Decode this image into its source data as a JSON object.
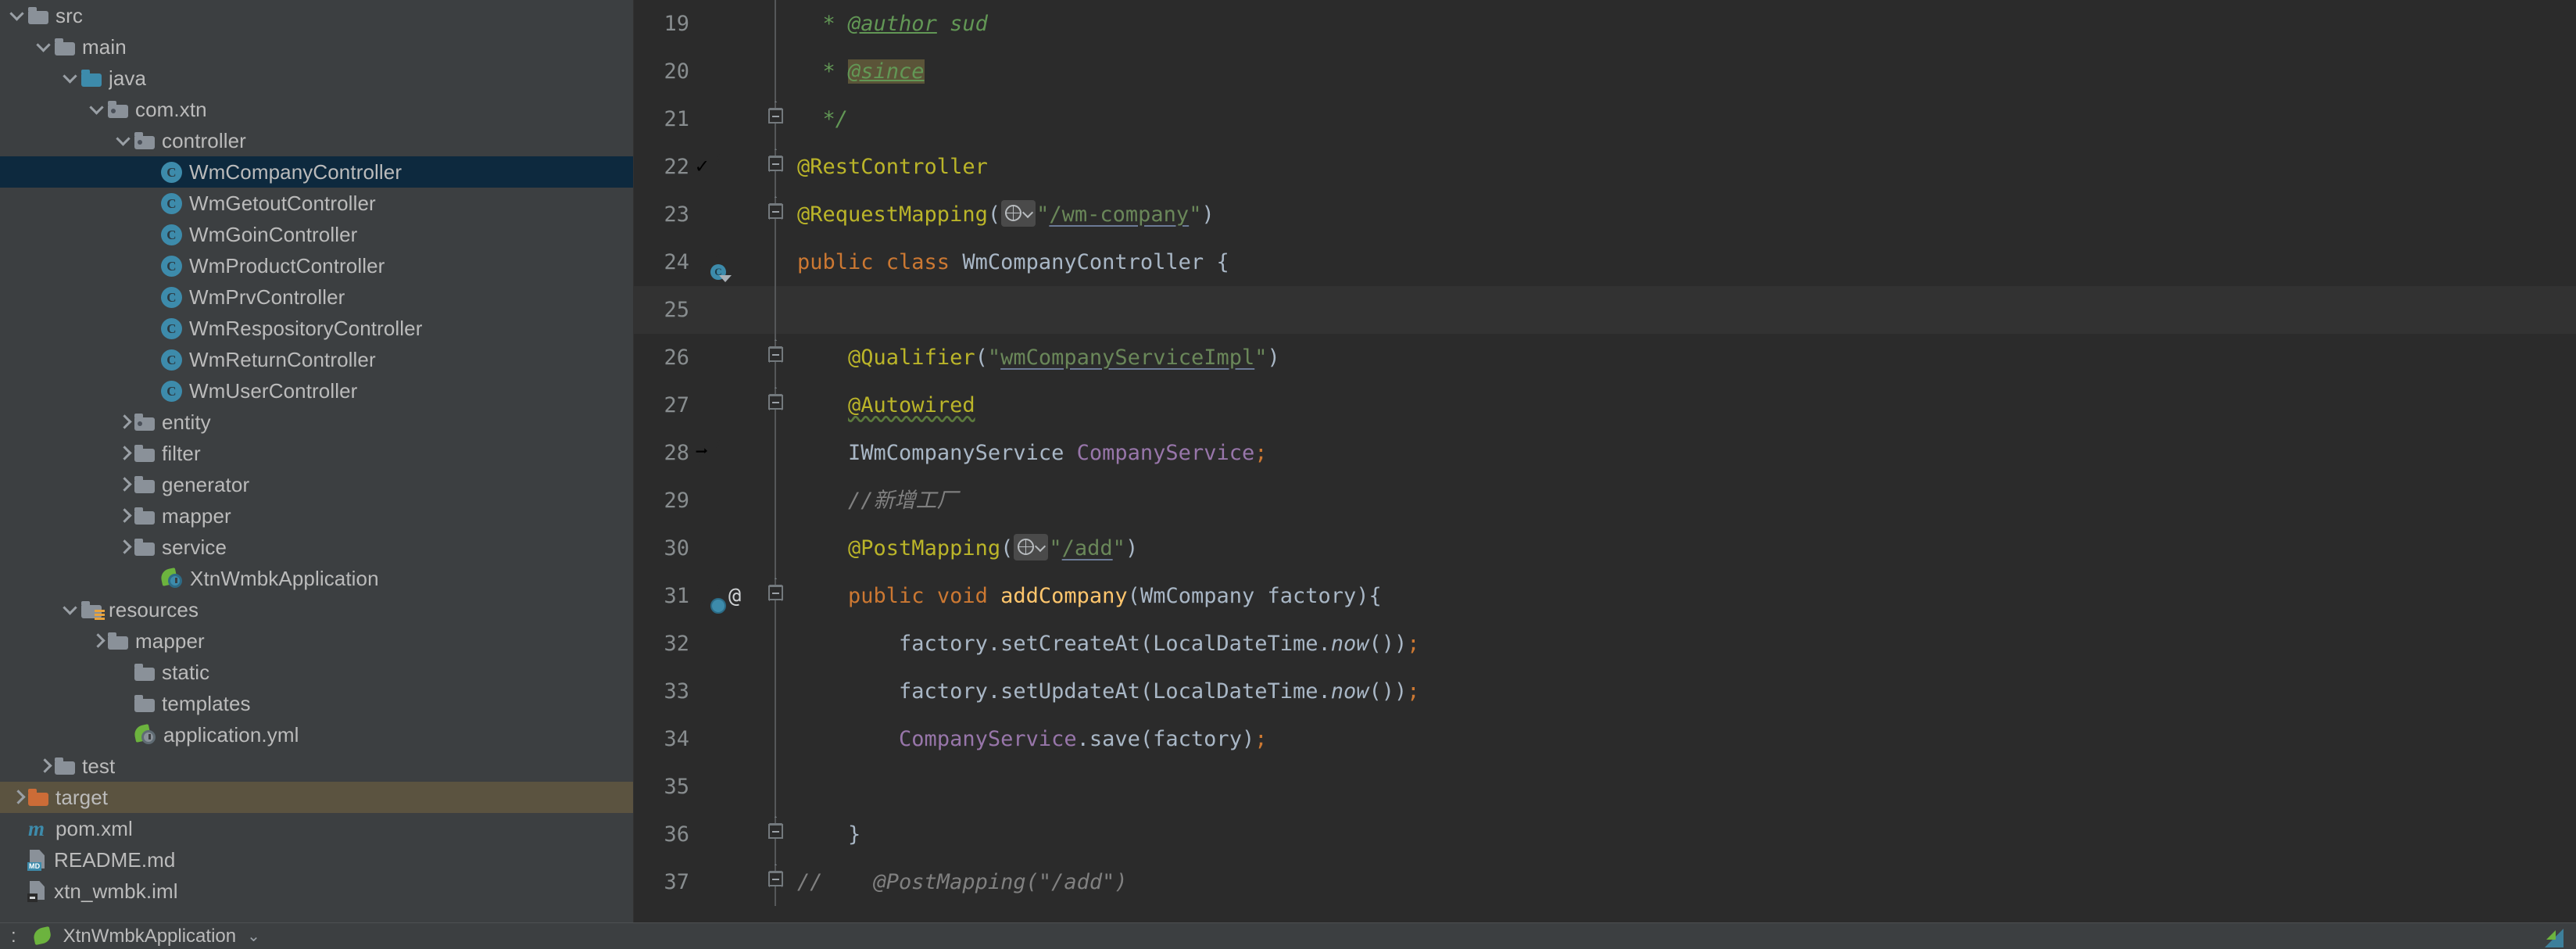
{
  "window": {
    "theme": "darcula",
    "accent_selection": "#0d293e",
    "accent_highlight": "#5b5340",
    "editor_bg": "#2b2b2b",
    "sidebar_bg": "#3c3f41"
  },
  "sidebar": {
    "name": "project-tree",
    "items": [
      {
        "label": "src",
        "indent": 0,
        "arrow": "down",
        "icon": "folder",
        "state": "normal"
      },
      {
        "label": "main",
        "indent": 1,
        "arrow": "down",
        "icon": "folder",
        "state": "normal"
      },
      {
        "label": "java",
        "indent": 2,
        "arrow": "down",
        "icon": "folder-blue",
        "state": "normal"
      },
      {
        "label": "com.xtn",
        "indent": 3,
        "arrow": "down",
        "icon": "folder-pkg",
        "state": "normal"
      },
      {
        "label": "controller",
        "indent": 4,
        "arrow": "down",
        "icon": "folder-pkg",
        "state": "normal"
      },
      {
        "label": "WmCompanyController",
        "indent": 5,
        "arrow": "none",
        "icon": "java-class",
        "state": "selected"
      },
      {
        "label": "WmGetoutController",
        "indent": 5,
        "arrow": "none",
        "icon": "java-class",
        "state": "normal"
      },
      {
        "label": "WmGoinController",
        "indent": 5,
        "arrow": "none",
        "icon": "java-class",
        "state": "normal"
      },
      {
        "label": "WmProductController",
        "indent": 5,
        "arrow": "none",
        "icon": "java-class",
        "state": "normal"
      },
      {
        "label": "WmPrvController",
        "indent": 5,
        "arrow": "none",
        "icon": "java-class",
        "state": "normal"
      },
      {
        "label": "WmRespositoryController",
        "indent": 5,
        "arrow": "none",
        "icon": "java-class",
        "state": "normal"
      },
      {
        "label": "WmReturnController",
        "indent": 5,
        "arrow": "none",
        "icon": "java-class",
        "state": "normal"
      },
      {
        "label": "WmUserController",
        "indent": 5,
        "arrow": "none",
        "icon": "java-class",
        "state": "normal"
      },
      {
        "label": "entity",
        "indent": 4,
        "arrow": "right",
        "icon": "folder-pkg",
        "state": "normal"
      },
      {
        "label": "filter",
        "indent": 4,
        "arrow": "right",
        "icon": "folder",
        "state": "normal"
      },
      {
        "label": "generator",
        "indent": 4,
        "arrow": "right",
        "icon": "folder",
        "state": "normal"
      },
      {
        "label": "mapper",
        "indent": 4,
        "arrow": "right",
        "icon": "folder",
        "state": "normal"
      },
      {
        "label": "service",
        "indent": 4,
        "arrow": "right",
        "icon": "folder",
        "state": "normal"
      },
      {
        "label": "XtnWmbkApplication",
        "indent": 5,
        "arrow": "none",
        "icon": "spring-app",
        "state": "normal"
      },
      {
        "label": "resources",
        "indent": 2,
        "arrow": "down",
        "icon": "folder-res",
        "state": "normal"
      },
      {
        "label": "mapper",
        "indent": 3,
        "arrow": "right",
        "icon": "folder",
        "state": "normal"
      },
      {
        "label": "static",
        "indent": 4,
        "arrow": "none",
        "icon": "folder",
        "state": "normal"
      },
      {
        "label": "templates",
        "indent": 4,
        "arrow": "none",
        "icon": "folder",
        "state": "normal"
      },
      {
        "label": "application.yml",
        "indent": 4,
        "arrow": "none",
        "icon": "spring-yml",
        "state": "normal"
      },
      {
        "label": "test",
        "indent": 1,
        "arrow": "right",
        "icon": "folder",
        "state": "normal"
      },
      {
        "label": "target",
        "indent": 0,
        "arrow": "right",
        "icon": "folder-orange",
        "state": "highlight"
      },
      {
        "label": "pom.xml",
        "indent": 0,
        "arrow": "none",
        "icon": "maven",
        "state": "normal"
      },
      {
        "label": "README.md",
        "indent": 0,
        "arrow": "none",
        "icon": "file-md",
        "state": "normal"
      },
      {
        "label": "xtn_wmbk.iml",
        "indent": 0,
        "arrow": "none",
        "icon": "file-iml",
        "state": "normal"
      }
    ]
  },
  "editor": {
    "name": "code-editor",
    "language": "java",
    "file": "WmCompanyController",
    "caret_line": 25,
    "first_visible_line": 19,
    "lines": [
      {
        "num": 19,
        "gutter_icon": null,
        "fold": null,
        "tokens": [
          {
            "text": "  * ",
            "cls": "t-cmtdoc"
          },
          {
            "text": "@author",
            "cls": "t-tag"
          },
          {
            "text": " sud",
            "cls": "t-cmtdoc"
          }
        ]
      },
      {
        "num": 20,
        "gutter_icon": null,
        "fold": null,
        "tokens": [
          {
            "text": "  * ",
            "cls": "t-cmtdoc"
          },
          {
            "text": "@since",
            "cls": "t-tag-hl"
          }
        ]
      },
      {
        "num": 21,
        "gutter_icon": null,
        "fold": "collapse-end",
        "tokens": [
          {
            "text": "  */",
            "cls": "t-cmtdoc"
          }
        ]
      },
      {
        "num": 22,
        "gutter_icon": "spring-bean-check",
        "fold": "collapse-box",
        "tokens": [
          {
            "text": "@RestController",
            "cls": "t-ann"
          }
        ]
      },
      {
        "num": 23,
        "gutter_icon": null,
        "fold": "collapse-box",
        "tokens": [
          {
            "text": "@RequestMapping",
            "cls": "t-ann"
          },
          {
            "text": "(",
            "cls": "t-punc"
          },
          {
            "text": "",
            "cls": "globe-chip"
          },
          {
            "text": "\"",
            "cls": "t-str"
          },
          {
            "text": "/wm-company",
            "cls": "t-strlnk"
          },
          {
            "text": "\"",
            "cls": "t-str"
          },
          {
            "text": ")",
            "cls": "t-punc"
          }
        ]
      },
      {
        "num": 24,
        "gutter_icon": "spring-bean-class",
        "fold": null,
        "tokens": [
          {
            "text": "public class ",
            "cls": "t-kw"
          },
          {
            "text": "WmCompanyController ",
            "cls": "t-cls"
          },
          {
            "text": "{",
            "cls": "t-punc"
          }
        ]
      },
      {
        "num": 25,
        "gutter_icon": null,
        "fold": null,
        "caret": true,
        "tokens": [
          {
            "text": "",
            "cls": "t-plain"
          }
        ]
      },
      {
        "num": 26,
        "gutter_icon": null,
        "fold": "collapse-box",
        "tokens": [
          {
            "text": "    ",
            "cls": "t-plain"
          },
          {
            "text": "@Qualifier",
            "cls": "t-ann"
          },
          {
            "text": "(",
            "cls": "t-punc"
          },
          {
            "text": "\"",
            "cls": "t-str"
          },
          {
            "text": "wmCompanyServiceImpl",
            "cls": "t-strlnk"
          },
          {
            "text": "\"",
            "cls": "t-str"
          },
          {
            "text": ")",
            "cls": "t-punc"
          }
        ]
      },
      {
        "num": 27,
        "gutter_icon": null,
        "fold": "collapse-box",
        "tokens": [
          {
            "text": "    ",
            "cls": "t-plain"
          },
          {
            "text": "@Autowired",
            "cls": "t-ann-w"
          }
        ]
      },
      {
        "num": 28,
        "gutter_icon": "spring-bean-arrow",
        "fold": null,
        "tokens": [
          {
            "text": "    ",
            "cls": "t-plain"
          },
          {
            "text": "IWmCompanyService ",
            "cls": "t-cls"
          },
          {
            "text": "CompanyService",
            "cls": "t-fld"
          },
          {
            "text": ";",
            "cls": "t-semi"
          }
        ]
      },
      {
        "num": 29,
        "gutter_icon": null,
        "fold": null,
        "tokens": [
          {
            "text": "    ",
            "cls": "t-plain"
          },
          {
            "text": "//新增工厂",
            "cls": "t-lcmt"
          }
        ]
      },
      {
        "num": 30,
        "gutter_icon": null,
        "fold": null,
        "tokens": [
          {
            "text": "    ",
            "cls": "t-plain"
          },
          {
            "text": "@PostMapping",
            "cls": "t-ann"
          },
          {
            "text": "(",
            "cls": "t-punc"
          },
          {
            "text": "",
            "cls": "globe-chip"
          },
          {
            "text": "\"",
            "cls": "t-str"
          },
          {
            "text": "/add",
            "cls": "t-strlnk"
          },
          {
            "text": "\"",
            "cls": "t-str"
          },
          {
            "text": ")",
            "cls": "t-punc"
          }
        ]
      },
      {
        "num": 31,
        "gutter_icon": "spring-bean-globe",
        "gutter_icon2": "at-sign",
        "fold": "collapse-box",
        "tokens": [
          {
            "text": "    ",
            "cls": "t-plain"
          },
          {
            "text": "public void ",
            "cls": "t-kw"
          },
          {
            "text": "addCompany",
            "cls": "t-mth"
          },
          {
            "text": "(",
            "cls": "t-punc"
          },
          {
            "text": "WmCompany factory",
            "cls": "t-cls"
          },
          {
            "text": "){",
            "cls": "t-punc"
          }
        ]
      },
      {
        "num": 32,
        "gutter_icon": null,
        "fold": null,
        "tokens": [
          {
            "text": "        factory.setCreateAt(LocalDateTime.",
            "cls": "t-plain"
          },
          {
            "text": "now",
            "cls": "t-ital"
          },
          {
            "text": "())",
            "cls": "t-plain"
          },
          {
            "text": ";",
            "cls": "t-semi"
          }
        ]
      },
      {
        "num": 33,
        "gutter_icon": null,
        "fold": null,
        "tokens": [
          {
            "text": "        factory.setUpdateAt(LocalDateTime.",
            "cls": "t-plain"
          },
          {
            "text": "now",
            "cls": "t-ital"
          },
          {
            "text": "())",
            "cls": "t-plain"
          },
          {
            "text": ";",
            "cls": "t-semi"
          }
        ]
      },
      {
        "num": 34,
        "gutter_icon": null,
        "fold": null,
        "tokens": [
          {
            "text": "        ",
            "cls": "t-plain"
          },
          {
            "text": "CompanyService",
            "cls": "t-fld"
          },
          {
            "text": ".save(factory)",
            "cls": "t-plain"
          },
          {
            "text": ";",
            "cls": "t-semi"
          }
        ]
      },
      {
        "num": 35,
        "gutter_icon": null,
        "fold": null,
        "tokens": [
          {
            "text": "",
            "cls": "t-plain"
          }
        ]
      },
      {
        "num": 36,
        "gutter_icon": null,
        "fold": "collapse-end",
        "tokens": [
          {
            "text": "    ",
            "cls": "t-plain"
          },
          {
            "text": "}",
            "cls": "t-punc"
          }
        ]
      },
      {
        "num": 37,
        "gutter_icon": null,
        "fold": "collapse-box",
        "tokens": [
          {
            "text": "//    @PostMapping(\"/add\")",
            "cls": "t-lcmt"
          }
        ]
      }
    ]
  },
  "bottom_bar": {
    "name": "run-configuration-bar",
    "prefix_label": ":",
    "config_name": "XtnWmbkApplication",
    "chevron": "⌄"
  }
}
